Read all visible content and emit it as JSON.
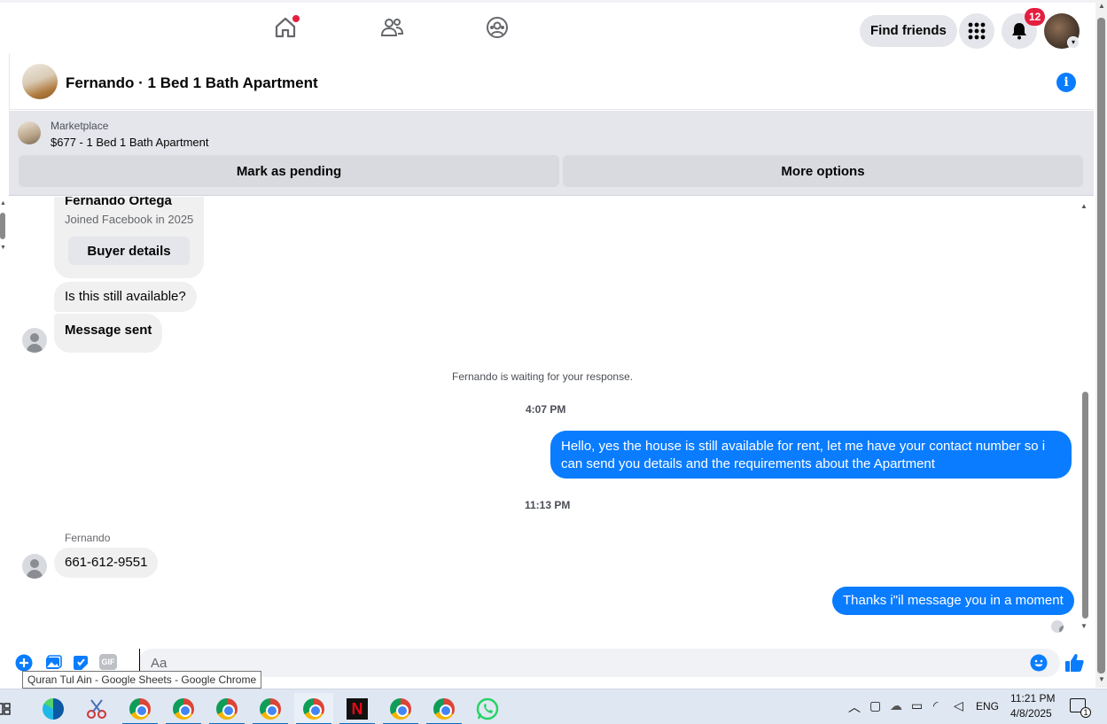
{
  "topnav": {
    "find_friends_label": "Find friends",
    "notifications_count": "12"
  },
  "chat": {
    "title": "Fernando · 1 Bed 1 Bath Apartment"
  },
  "marketplace": {
    "label": "Marketplace",
    "listing": "$677 - 1 Bed 1 Bath Apartment",
    "mark_pending_label": "Mark as pending",
    "more_options_label": "More options"
  },
  "profile_card": {
    "name": "Fernando Ortega",
    "joined": "Joined Facebook in 2025",
    "buyer_details_label": "Buyer details"
  },
  "messages": {
    "m1": "Is this still available?",
    "m2": "Message sent",
    "waiting": "Fernando is waiting for your response.",
    "time1": "4:07 PM",
    "out1": "Hello, yes the house is still available for rent, let me have your contact number so i can send you details and the requirements about the  Apartment",
    "time2": "11:13 PM",
    "sender_name": "Fernando",
    "in3": "661-612-9551",
    "out2": "Thanks i\"il message you in a moment"
  },
  "composer": {
    "placeholder": "Aa",
    "gif_label": "GIF"
  },
  "tooltip": "Quran Tul Ain - Google Sheets - Google Chrome",
  "taskbar": {
    "language": "ENG",
    "time": "11:21 PM",
    "date": "4/8/2025",
    "notification_count": "1"
  },
  "colors": {
    "accent": "#0a7cff",
    "badge": "#e41e3f",
    "incoming_bubble": "#f0f0f0"
  }
}
